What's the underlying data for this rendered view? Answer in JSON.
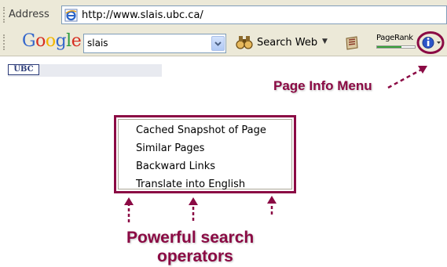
{
  "address_bar": {
    "label": "Address",
    "url": "http://www.slais.ubc.ca/"
  },
  "google_toolbar": {
    "search_value": "slais",
    "search_web_label": "Search Web",
    "pagerank_label": "PageRank",
    "pagerank_fill_fraction": 0.65
  },
  "page": {
    "logo_text": "UBC"
  },
  "annotations": {
    "page_info_menu": "Page Info Menu",
    "operators_line1": "Powerful search",
    "operators_line2": "operators"
  },
  "page_info_menu": {
    "items": [
      "Cached Snapshot of Page",
      "Similar Pages",
      "Backward Links",
      "Translate into English"
    ]
  },
  "colors": {
    "annotation": "#8b0a44",
    "toolbar_bg": "#ece9d8"
  }
}
